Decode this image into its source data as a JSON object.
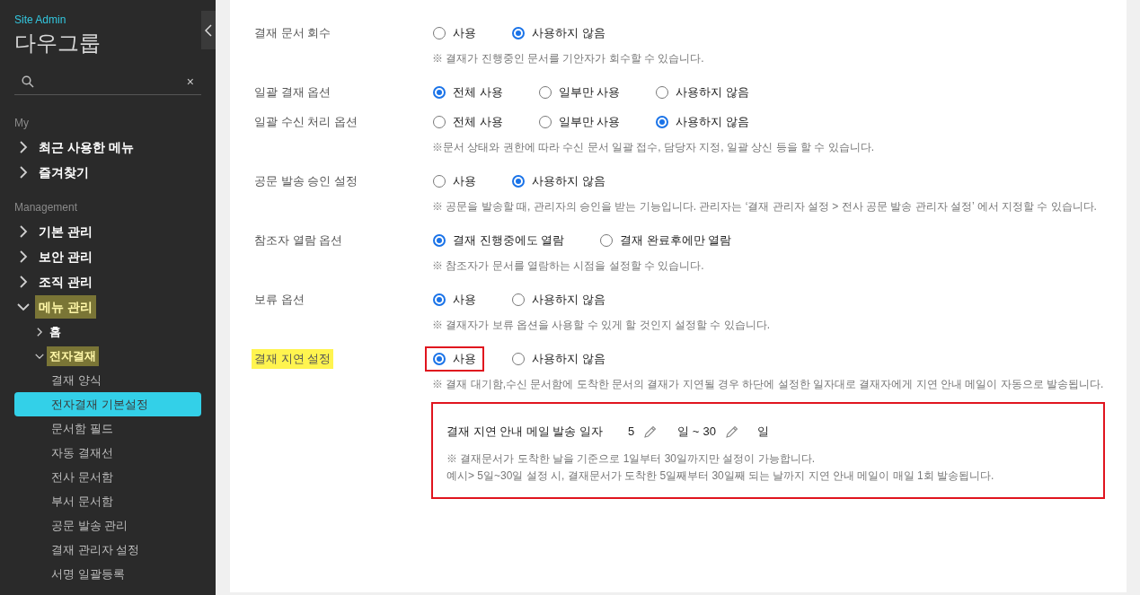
{
  "sidebar": {
    "subtitle": "Site Admin",
    "title": "다우그룹",
    "search": {
      "clear": "×"
    },
    "sections": [
      {
        "heading": "My",
        "items": [
          {
            "label": "최근 사용한 메뉴",
            "expanded": false,
            "highlighted": false
          },
          {
            "label": "즐겨찾기",
            "expanded": false,
            "highlighted": false
          }
        ]
      },
      {
        "heading": "Management",
        "items": [
          {
            "label": "기본 관리",
            "expanded": false,
            "highlighted": false
          },
          {
            "label": "보안 관리",
            "expanded": false,
            "highlighted": false
          },
          {
            "label": "조직 관리",
            "expanded": false,
            "highlighted": false
          },
          {
            "label": "메뉴 관리",
            "expanded": true,
            "highlighted": true,
            "children": [
              {
                "label": "홈",
                "expanded": false,
                "highlighted": false
              },
              {
                "label": "전자결재",
                "expanded": true,
                "highlighted": true,
                "children": [
                  {
                    "label": "결재 양식",
                    "selected": false
                  },
                  {
                    "label": "전자결재 기본설정",
                    "selected": true
                  },
                  {
                    "label": "문서함 필드",
                    "selected": false
                  },
                  {
                    "label": "자동 결재선",
                    "selected": false
                  },
                  {
                    "label": "전사 문서함",
                    "selected": false
                  },
                  {
                    "label": "부서 문서함",
                    "selected": false
                  },
                  {
                    "label": "공문 발송 관리",
                    "selected": false
                  },
                  {
                    "label": "결재 관리자 설정",
                    "selected": false
                  },
                  {
                    "label": "서명 일괄등록",
                    "selected": false
                  }
                ]
              }
            ]
          }
        ]
      }
    ]
  },
  "settings": [
    {
      "label": "결재 문서 회수",
      "highlighted": false,
      "options": [
        {
          "label": "사용",
          "selected": false,
          "outlined": false
        },
        {
          "label": "사용하지 않음",
          "selected": true,
          "outlined": false
        }
      ],
      "hint": "※ 결재가 진행중인 문서를 기안자가 회수할 수 있습니다."
    },
    {
      "label": "일괄 결재 옵션",
      "highlighted": false,
      "options": [
        {
          "label": "전체 사용",
          "selected": true,
          "outlined": false
        },
        {
          "label": "일부만 사용",
          "selected": false,
          "outlined": false
        },
        {
          "label": "사용하지 않음",
          "selected": false,
          "outlined": false
        }
      ]
    },
    {
      "label": "일괄 수신 처리 옵션",
      "highlighted": false,
      "options": [
        {
          "label": "전체 사용",
          "selected": false,
          "outlined": false
        },
        {
          "label": "일부만 사용",
          "selected": false,
          "outlined": false
        },
        {
          "label": "사용하지 않음",
          "selected": true,
          "outlined": false
        }
      ],
      "hint": "※문서 상태와 권한에 따라 수신 문서 일괄 접수, 담당자 지정, 일괄 상신 등을 할 수 있습니다."
    },
    {
      "label": "공문 발송 승인 설정",
      "highlighted": false,
      "options": [
        {
          "label": "사용",
          "selected": false,
          "outlined": false
        },
        {
          "label": "사용하지 않음",
          "selected": true,
          "outlined": false
        }
      ],
      "hint": "※ 공문을 발송할 때, 관리자의 승인을 받는 기능입니다. 관리자는 ‘결재 관리자 설정 > 전사 공문 발송 관리자 설정’ 에서 지정할 수 있습니다."
    },
    {
      "label": "참조자 열람 옵션",
      "highlighted": false,
      "options": [
        {
          "label": "결재 진행중에도 열람",
          "selected": true,
          "outlined": false
        },
        {
          "label": "결재 완료후에만 열람",
          "selected": false,
          "outlined": false
        }
      ],
      "hint": "※ 참조자가 문서를 열람하는 시점을 설정할 수 있습니다."
    },
    {
      "label": "보류 옵션",
      "highlighted": false,
      "options": [
        {
          "label": "사용",
          "selected": true,
          "outlined": false
        },
        {
          "label": "사용하지 않음",
          "selected": false,
          "outlined": false
        }
      ],
      "hint": "※ 결재자가 보류 옵션을 사용할 수 있게 할 것인지 설정할 수 있습니다."
    },
    {
      "label": "결재 지연 설정",
      "highlighted": true,
      "options": [
        {
          "label": "사용",
          "selected": true,
          "outlined": true
        },
        {
          "label": "사용하지 않음",
          "selected": false,
          "outlined": false
        }
      ],
      "hint": "※ 결재 대기함,수신 문서함에 도착한 문서의 결재가 지연될 경우 하단에 설정한 일자대로 결재자에게 지연 안내 메일이 자동으로 발송됩니다.",
      "detail": {
        "label": "결재 지연 안내 메일 발송 일자",
        "from": "5",
        "from_unit": "일 ~",
        "to": "30",
        "to_unit": "일",
        "notes": [
          "※ 결재문서가 도착한 날을 기준으로 1일부터 30일까지만 설정이 가능합니다.",
          "예시> 5일~30일 설정 시, 결재문서가 도착한 5일째부터 30일째 되는 날까지 지연 안내 메일이 매일 1회 발송됩니다."
        ]
      }
    }
  ]
}
